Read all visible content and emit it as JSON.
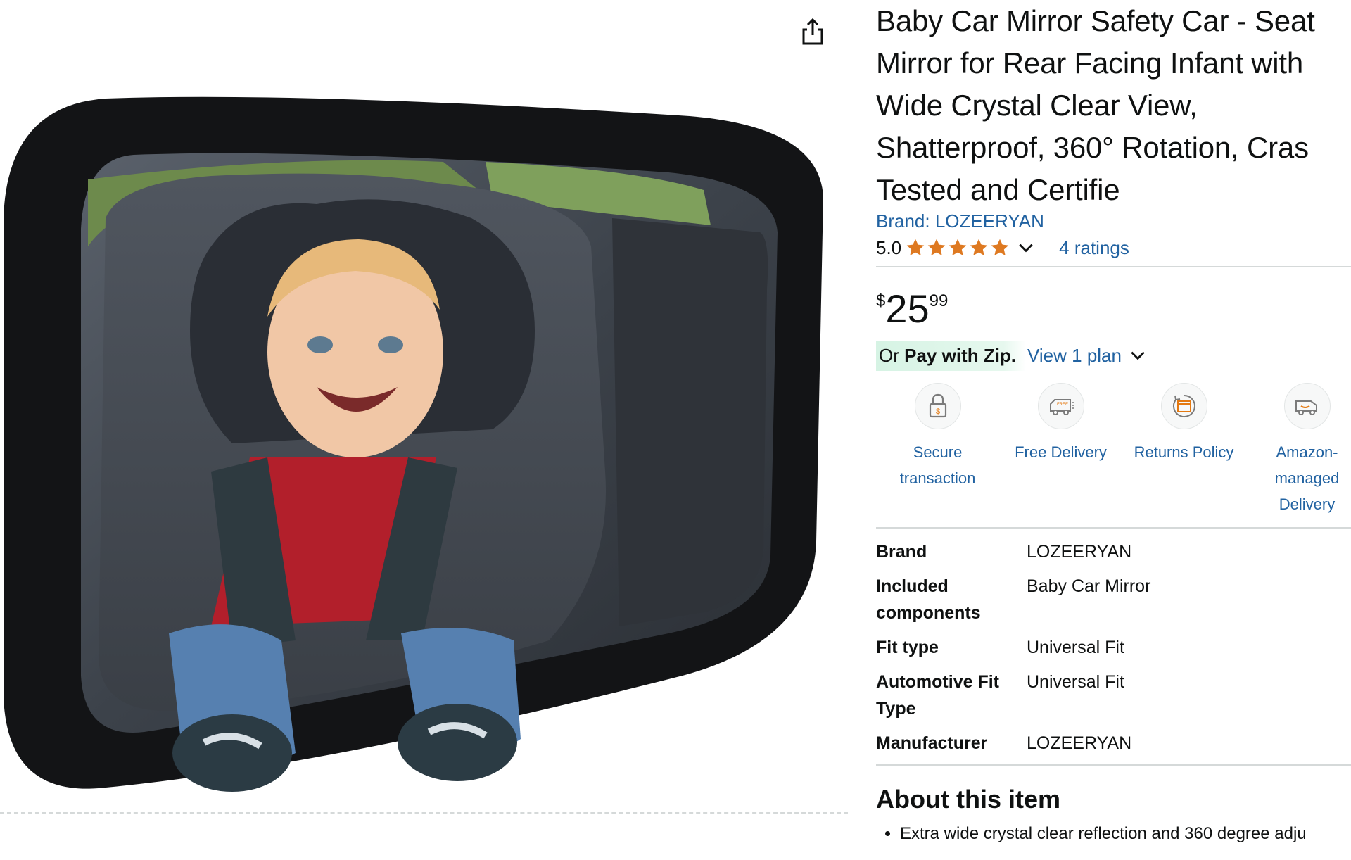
{
  "share": {
    "icon": "share-icon"
  },
  "product": {
    "title_lines": [
      "Baby Car Mirror Safety Car - Seat",
      "Mirror for Rear Facing Infant with",
      "Wide Crystal Clear View,",
      "Shatterproof, 360° Rotation, Cras",
      "Tested and Certifie"
    ],
    "brand_link": "Brand: LOZEERYAN",
    "rating_score": "5.0",
    "rating_stars": 5,
    "ratings_count": "4 ratings",
    "price": {
      "symbol": "$",
      "whole": "25",
      "fraction": "99"
    },
    "zip": {
      "prefix": "Or ",
      "bold": "Pay with Zip.",
      "link": "View 1 plan"
    },
    "features": [
      {
        "icon": "secure-lock-icon",
        "label": "Secure transaction"
      },
      {
        "icon": "free-delivery-truck-icon",
        "label": "Free Delivery"
      },
      {
        "icon": "returns-box-icon",
        "label": "Returns Policy"
      },
      {
        "icon": "amazon-delivery-van-icon",
        "label": "Amazon-managed Delivery"
      }
    ],
    "specs": [
      {
        "key": "Brand",
        "value": "LOZEERYAN"
      },
      {
        "key": "Included components",
        "value": "Baby Car Mirror"
      },
      {
        "key": "Fit type",
        "value": "Universal Fit"
      },
      {
        "key": "Automotive Fit Type",
        "value": "Universal Fit"
      },
      {
        "key": "Manufacturer",
        "value": "LOZEERYAN"
      }
    ],
    "about_heading": "About this item",
    "about_bullets": [
      "Extra wide crystal clear reflection and 360 degree adju"
    ]
  },
  "colors": {
    "link": "#2162a1",
    "star": "#de7921",
    "text": "#0f1111",
    "zip_bg": "#d6f3e4"
  }
}
